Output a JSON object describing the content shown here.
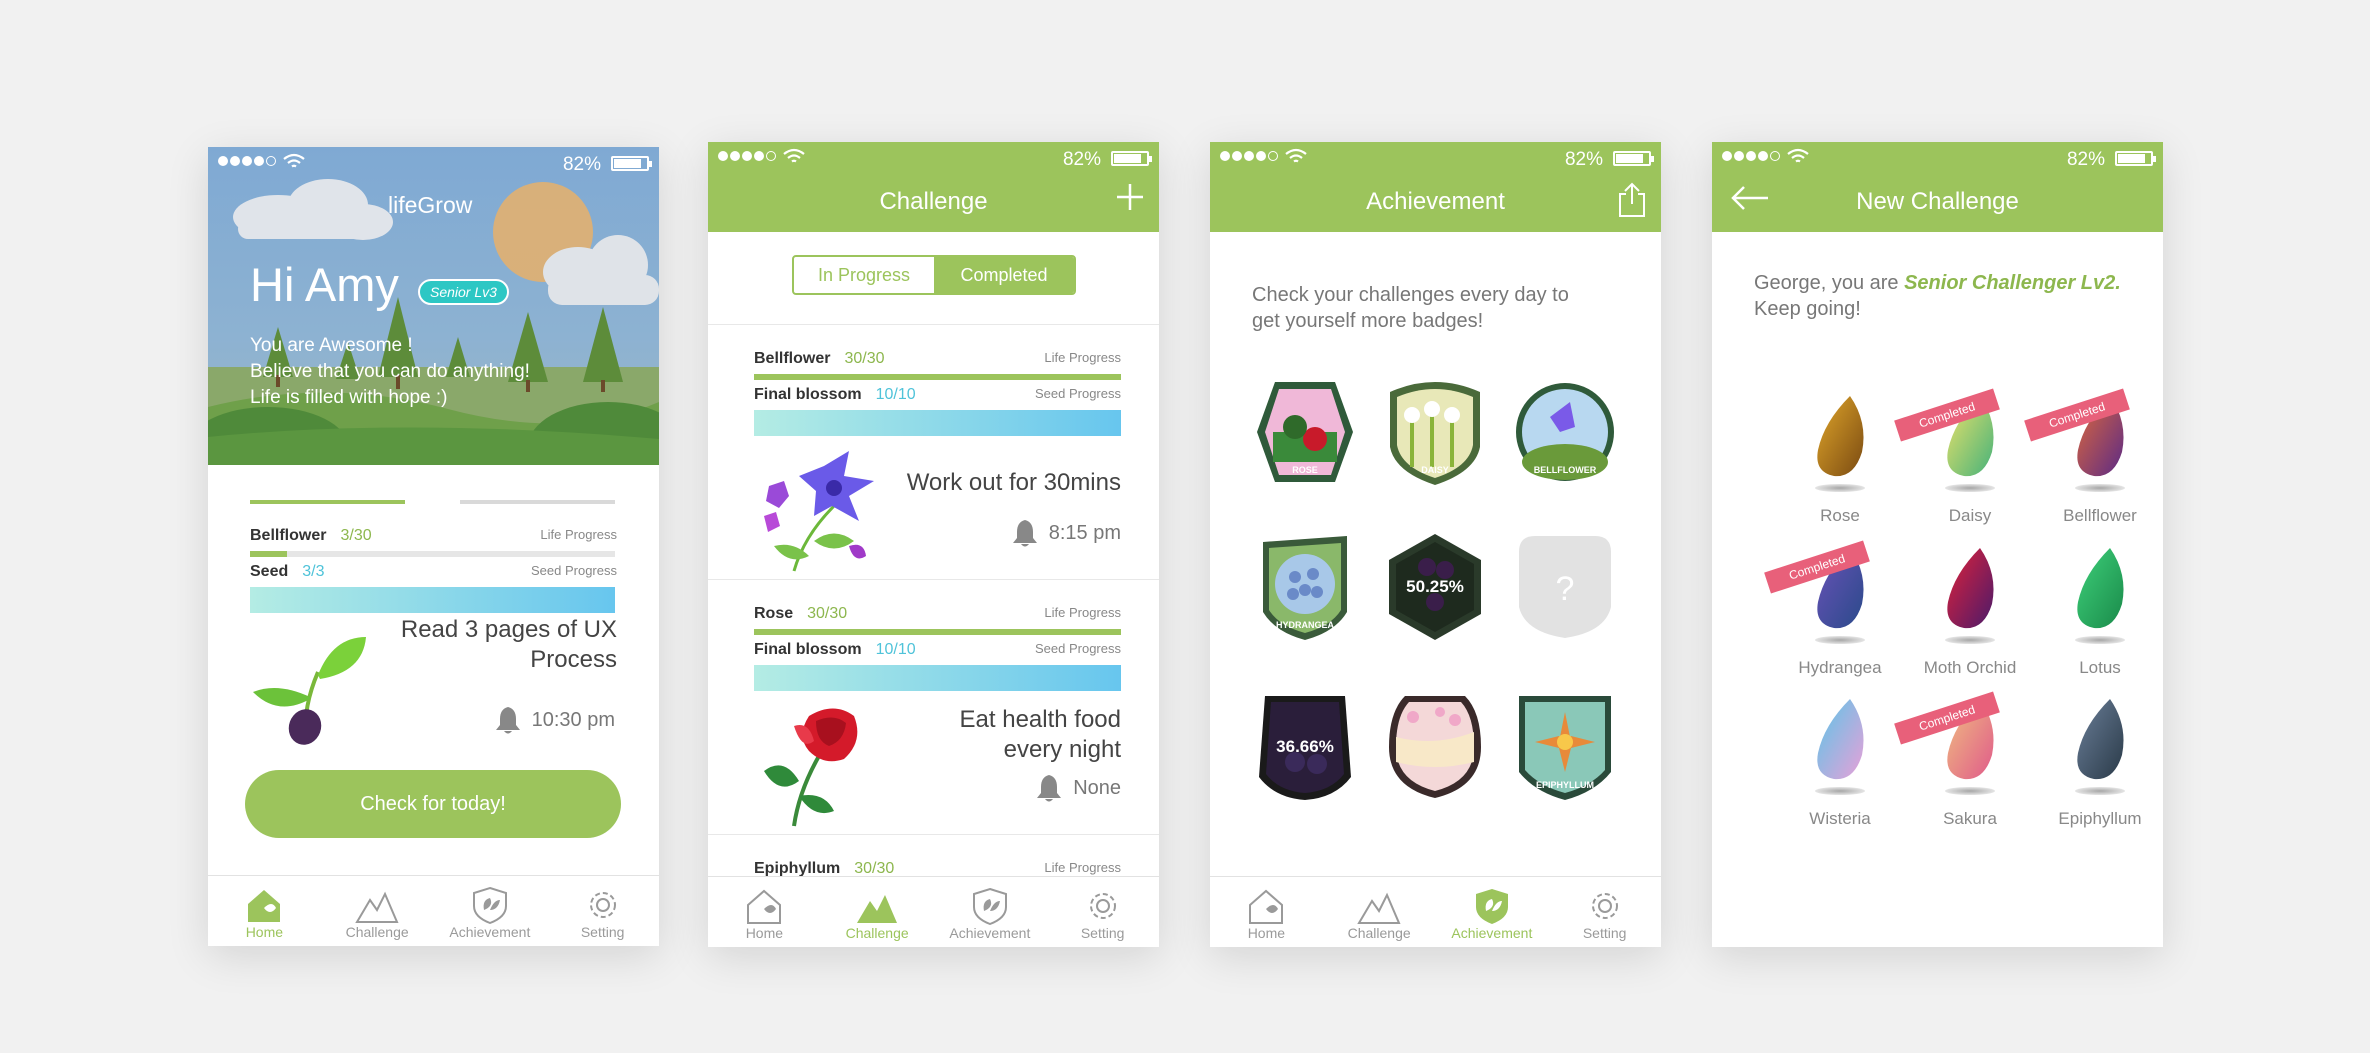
{
  "status": {
    "percent": "82%"
  },
  "tabs": {
    "home": "Home",
    "challenge": "Challenge",
    "achievement": "Achievement",
    "setting": "Setting"
  },
  "home": {
    "brand": "lifeGrow",
    "greeting": "Hi Amy",
    "level_badge": "Senior Lv3",
    "quote": [
      "You are Awesome !",
      "Believe that you can do anything!",
      "Life is filled with hope :)"
    ],
    "life": {
      "name": "Bellflower",
      "count": "3/30",
      "label": "Life Progress",
      "fraction": 0.1
    },
    "seed": {
      "name": "Seed",
      "count": "3/3",
      "label": "Seed Progress"
    },
    "task": [
      "Read 3 pages of UX",
      "Process"
    ],
    "reminder": "10:30 pm",
    "cta": "Check for today!"
  },
  "challenge": {
    "title": "Challenge",
    "segments": {
      "in_progress": "In Progress",
      "completed": "Completed"
    },
    "items": [
      {
        "name": "Bellflower",
        "count": "30/30",
        "life_label": "Life Progress",
        "stage": "Final blossom",
        "stage_count": "10/10",
        "stage_label": "Seed Progress",
        "task": [
          "Work out for 30mins"
        ],
        "reminder": "8:15 pm"
      },
      {
        "name": "Rose",
        "count": "30/30",
        "life_label": "Life Progress",
        "stage": "Final blossom",
        "stage_count": "10/10",
        "stage_label": "Seed Progress",
        "task": [
          "Eat health food",
          "every night"
        ],
        "reminder": "None"
      },
      {
        "name": "Epiphyllum",
        "count": "30/30",
        "life_label": "Life Progress"
      }
    ]
  },
  "achievement": {
    "title": "Achievement",
    "intro": [
      "Check your challenges every day to",
      "get yourself more badges!"
    ],
    "badges": [
      {
        "name": "ROSE"
      },
      {
        "name": "DAISY"
      },
      {
        "name": "BELLFLOWER"
      },
      {
        "name": "HYDRANGEA"
      },
      {
        "name": "in-progress",
        "pct": "50.25%"
      },
      {
        "name": "locked",
        "symbol": "?"
      },
      {
        "name": "in-progress",
        "pct": "36.66%"
      },
      {
        "name": "sakura"
      },
      {
        "name": "EPIPHYLLUM"
      }
    ]
  },
  "new_challenge": {
    "title": "New Challenge",
    "intro_prefix": "George, you are ",
    "intro_level": "Senior Challenger Lv2.",
    "intro_suffix": "  Keep going!",
    "ribbon": "Completed",
    "seeds": [
      {
        "label": "Rose",
        "completed": false,
        "colors": [
          "#e0a62a",
          "#7a4a12"
        ]
      },
      {
        "label": "Daisy",
        "completed": true,
        "colors": [
          "#f0e36a",
          "#45b27a"
        ]
      },
      {
        "label": "Bellflower",
        "completed": true,
        "colors": [
          "#e06a3a",
          "#5b2a86"
        ]
      },
      {
        "label": "Hydrangea",
        "completed": true,
        "colors": [
          "#6a52b8",
          "#2a4a8a"
        ]
      },
      {
        "label": "Moth Orchid",
        "completed": false,
        "colors": [
          "#e0223a",
          "#4a1a6a"
        ]
      },
      {
        "label": "Lotus",
        "completed": false,
        "colors": [
          "#3ed07a",
          "#1a8a4a"
        ]
      },
      {
        "label": "Wisteria",
        "completed": false,
        "colors": [
          "#5ac6e8",
          "#e8a0d8"
        ]
      },
      {
        "label": "Sakura",
        "completed": true,
        "colors": [
          "#f0c080",
          "#e05a8a"
        ]
      },
      {
        "label": "Epiphyllum",
        "completed": false,
        "colors": [
          "#6a7e98",
          "#2a3a48"
        ]
      }
    ]
  }
}
